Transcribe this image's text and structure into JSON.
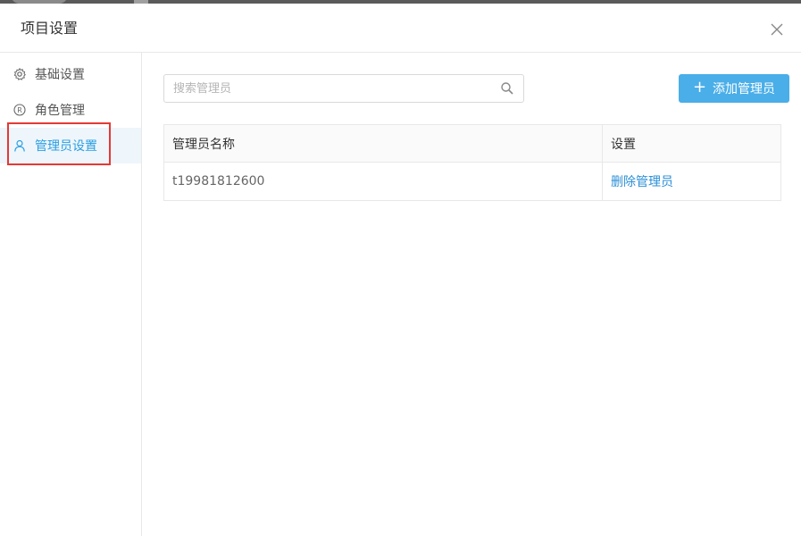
{
  "dialog": {
    "title": "项目设置"
  },
  "sidebar": {
    "items": [
      {
        "label": "基础设置",
        "icon": "gear-icon",
        "active": false
      },
      {
        "label": "角色管理",
        "icon": "registered-icon",
        "active": false
      },
      {
        "label": "管理员设置",
        "icon": "user-icon",
        "active": true
      }
    ]
  },
  "toolbar": {
    "search_placeholder": "搜索管理员",
    "search_value": "",
    "add_label": "添加管理员"
  },
  "table": {
    "headers": [
      "管理员名称",
      "设置"
    ],
    "rows": [
      {
        "name": "t19981812600",
        "action": "删除管理员"
      }
    ]
  },
  "colors": {
    "accent": "#4aaee8",
    "link": "#2b8fd6",
    "active_bg": "#eef6fc",
    "highlight": "#e53935"
  }
}
